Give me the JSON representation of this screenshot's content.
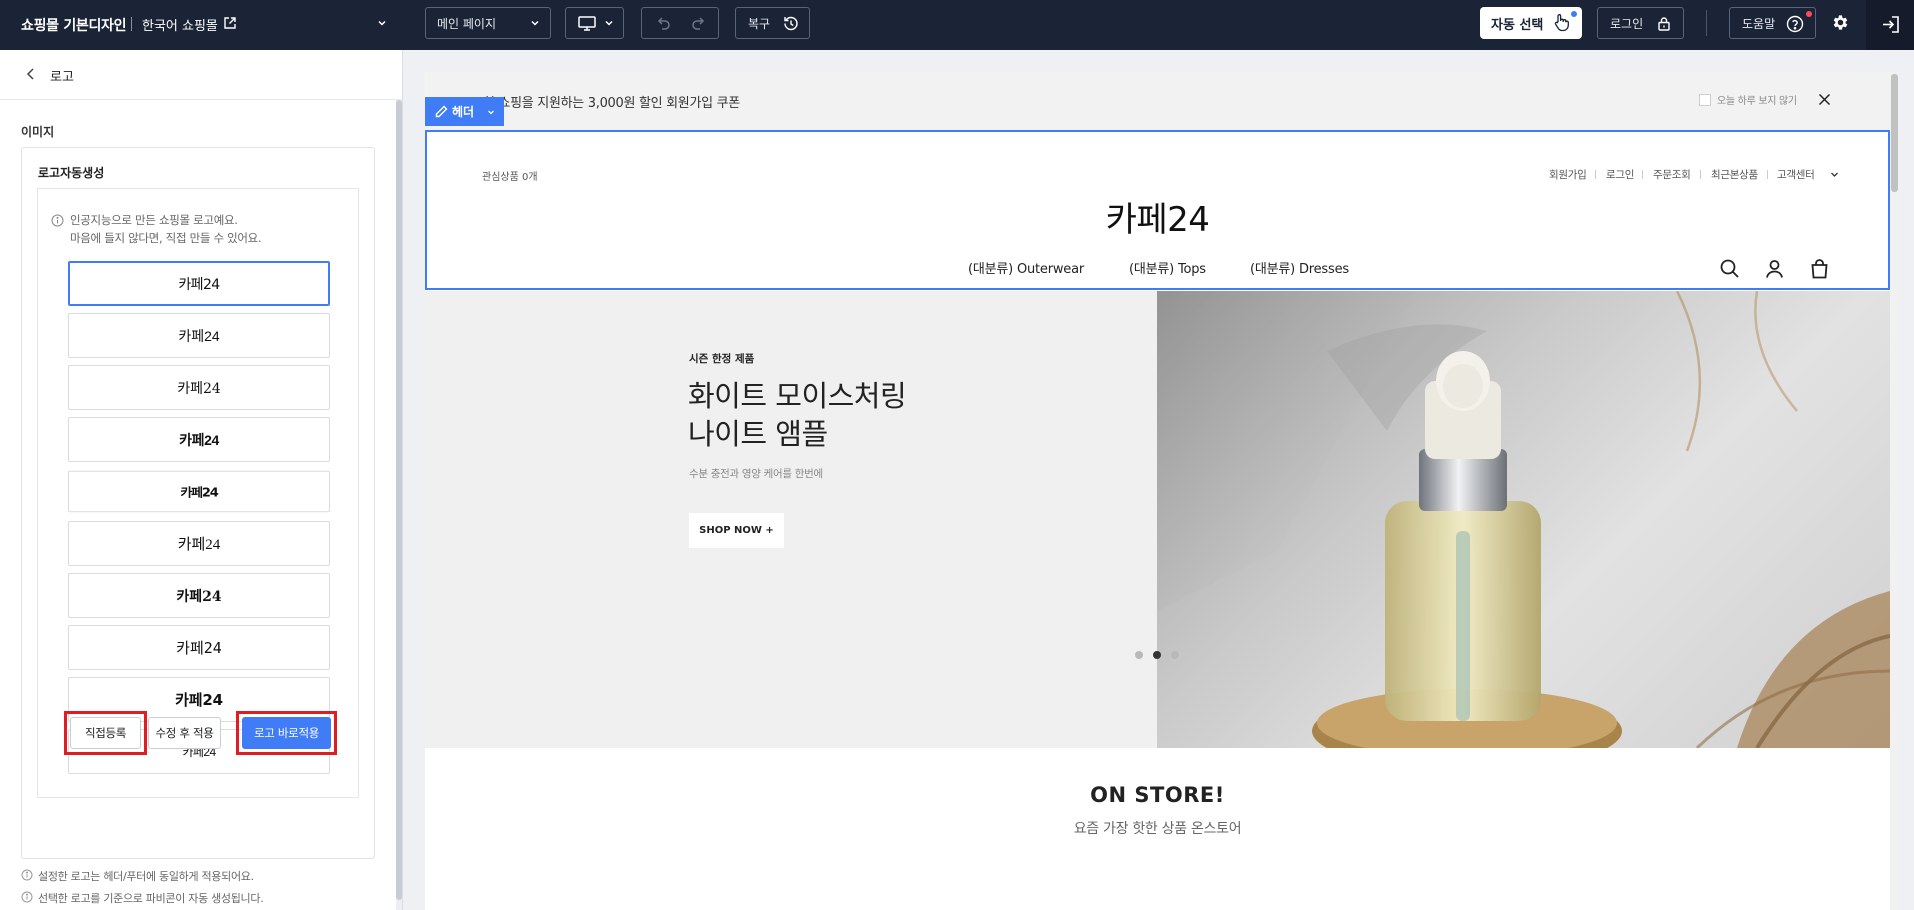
{
  "topbar": {
    "brand": "쇼핑몰 기본디자인",
    "mall": "한국어 쇼핑몰",
    "page_select": "메인 페이지",
    "restore_label": "복구",
    "auto_select_label": "자동 선택",
    "login_label": "로그인",
    "help_label": "도움말"
  },
  "panel": {
    "back_label": "로고",
    "section_title": "이미지",
    "card_title": "로고자동생성",
    "info_line1": "인공지능으로 만든 쇼핑몰 로고예요.",
    "info_line2": "마음에 들지 않다면, 직접 만들 수 있어요.",
    "logo_options": [
      "카페24",
      "카페24",
      "카페24",
      "카페24",
      "카페24",
      "카페24",
      "카페24",
      "카페24",
      "카페24",
      "카페24"
    ],
    "selected_index": 0,
    "btn_manual": "직접등록",
    "btn_edit_apply": "수정 후 적용",
    "btn_apply_now": "로고 바로적용",
    "note1": "설정한 로고는 헤더/푸터에 동일하게 적용되어요.",
    "note2": "선택한 로고를 기준으로 파비콘이 자동 생성됩니다."
  },
  "preview": {
    "coupon_text": "첫 쇼핑을 지원하는 3,000원 할인 회원가입 쿠폰",
    "not_today": "오늘 하루 보지 않기",
    "header_tag": "헤더",
    "wishlist": "관심상품 0개",
    "util_links": [
      "회원가입",
      "로그인",
      "주문조회",
      "최근본상품",
      "고객센터"
    ],
    "logo_text": "카페24",
    "nav": [
      "(대분류) Outerwear",
      "(대분류) Tops",
      "(대분류) Dresses"
    ],
    "hero_kicker": "시즌 한정 제품",
    "hero_title_line1": "화이트 모이스처링",
    "hero_title_line2": "나이트 앰플",
    "hero_sub": "수분 충전과 영양 케어를 한번에",
    "hero_button": "SHOP NOW +",
    "slide_active": 2,
    "slide_count": 3,
    "store_title": "ON STORE!",
    "store_sub": "요즘 가장 핫한 상품 온스토어"
  },
  "colors": {
    "topbar_bg": "#1b2336",
    "accent": "#3f7cf5",
    "highlight_red": "#e11d24"
  }
}
